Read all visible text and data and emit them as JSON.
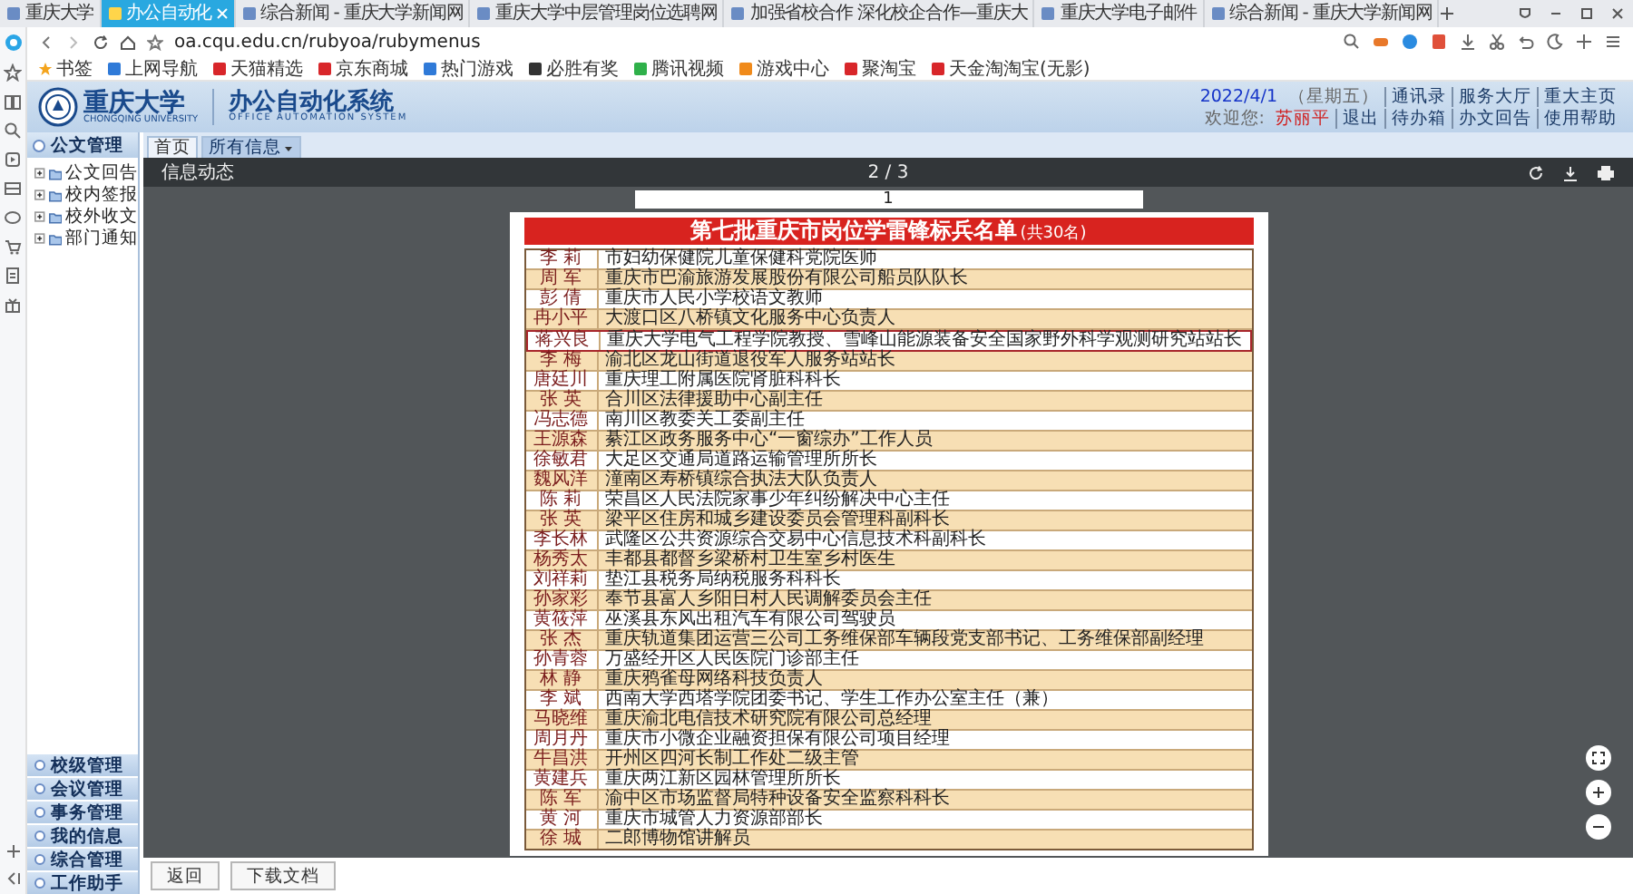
{
  "browser": {
    "tabs": [
      {
        "title": "重庆大学",
        "selected": false
      },
      {
        "title": "办公自动化",
        "selected": true
      },
      {
        "title": "综合新闻 - 重庆大学新闻网",
        "selected": false
      },
      {
        "title": "重庆大学中层管理岗位选聘网",
        "selected": false
      },
      {
        "title": "加强省校合作 深化校企合作—重庆大",
        "selected": false
      },
      {
        "title": "重庆大学电子邮件",
        "selected": false
      },
      {
        "title": "综合新闻 - 重庆大学新闻网",
        "selected": false
      }
    ],
    "address": "oa.cqu.edu.cn/rubyoa/rubymenus",
    "bookmarks": [
      "书签",
      "上网导航",
      "天猫精选",
      "京东商城",
      "热门游戏",
      "必胜有奖",
      "腾讯视频",
      "游戏中心",
      "聚淘宝",
      "天金淘淘宝(无影)"
    ]
  },
  "header": {
    "logo_text": "重庆大学",
    "logo_subtitle": "CHONGQING UNIVERSITY",
    "system_title": "办公自动化系统",
    "system_subtitle": "OFFICE AUTOMATION SYSTEM",
    "date": "2022/4/1",
    "weekday": "（星期五）",
    "top_links": [
      "通讯录",
      "服务大厅",
      "重大主页"
    ],
    "welcome": "欢迎您:",
    "user": "苏丽平",
    "user_links": [
      "退出",
      "待办箱",
      "办文回告",
      "使用帮助"
    ]
  },
  "sidebar": {
    "header": "公文管理",
    "tree": [
      {
        "label": "公文回告",
        "expanded": false
      },
      {
        "label": "校内签报",
        "expanded": false
      },
      {
        "label": "校外收文",
        "expanded": false
      },
      {
        "label": "部门通知",
        "expanded": false
      }
    ],
    "sections": [
      "校级管理",
      "会议管理",
      "事务管理",
      "我的信息",
      "综合管理",
      "工作助手"
    ]
  },
  "nav_tabs": [
    {
      "label": "首页",
      "selected": false,
      "dropdown": false
    },
    {
      "label": "所有信息",
      "selected": true,
      "dropdown": true
    }
  ],
  "viewer": {
    "title": "信息动态",
    "page": "2 / 3",
    "previous_page_number": "1",
    "document": {
      "title": "第七批重庆市岗位学雷锋标兵名单",
      "count": "(共30名)",
      "rows": [
        {
          "name": "李 莉",
          "duty": "市妇幼保健院儿童保健科党院医师",
          "highlighted": false
        },
        {
          "name": "周 军",
          "duty": "重庆市巴渝旅游发展股份有限公司船员队队长",
          "highlighted": false
        },
        {
          "name": "彭 倩",
          "duty": "重庆市人民小学校语文教师",
          "highlighted": false
        },
        {
          "name": "冉小平",
          "duty": "大渡口区八桥镇文化服务中心负责人",
          "highlighted": false
        },
        {
          "name": "蒋兴良",
          "duty": "重庆大学电气工程学院教授、雪峰山能源装备安全国家野外科学观测研究站站长",
          "highlighted": true
        },
        {
          "name": "李 梅",
          "duty": "渝北区龙山街道退役军人服务站站长",
          "highlighted": false
        },
        {
          "name": "唐廷川",
          "duty": "重庆理工附属医院肾脏科科长",
          "highlighted": false
        },
        {
          "name": "张 英",
          "duty": "合川区法律援助中心副主任",
          "highlighted": false
        },
        {
          "name": "冯志德",
          "duty": "南川区教委关工委副主任",
          "highlighted": false
        },
        {
          "name": "王源森",
          "duty": "綦江区政务服务中心“一窗综办”工作人员",
          "highlighted": false
        },
        {
          "name": "徐敏君",
          "duty": "大足区交通局道路运输管理所所长",
          "highlighted": false
        },
        {
          "name": "魏风洋",
          "duty": "潼南区寿桥镇综合执法大队负责人",
          "highlighted": false
        },
        {
          "name": "陈 莉",
          "duty": "荣昌区人民法院家事少年纠纷解决中心主任",
          "highlighted": false
        },
        {
          "name": "张 英",
          "duty": "梁平区住房和城乡建设委员会管理科副科长",
          "highlighted": false
        },
        {
          "name": "李长林",
          "duty": "武隆区公共资源综合交易中心信息技术科副科长",
          "highlighted": false
        },
        {
          "name": "杨秀太",
          "duty": "丰都县都督乡梁桥村卫生室乡村医生",
          "highlighted": false
        },
        {
          "name": "刘祥莉",
          "duty": "垫江县税务局纳税服务科科长",
          "highlighted": false
        },
        {
          "name": "孙家彩",
          "duty": "奉节县富人乡阳日村人民调解委员会主任",
          "highlighted": false
        },
        {
          "name": "黄筱萍",
          "duty": "巫溪县东风出租汽车有限公司驾驶员",
          "highlighted": false
        },
        {
          "name": "张 杰",
          "duty": "重庆轨道集团运营三公司工务维保部车辆段党支部书记、工务维保部副经理",
          "highlighted": false
        },
        {
          "name": "孙青蓉",
          "duty": "万盛经开区人民医院门诊部主任",
          "highlighted": false
        },
        {
          "name": "林 静",
          "duty": "重庆鸦雀母网络科技负责人",
          "highlighted": false
        },
        {
          "name": "李 斌",
          "duty": "西南大学西塔学院团委书记、学生工作办公室主任（兼）",
          "highlighted": false
        },
        {
          "name": "马晓维",
          "duty": "重庆渝北电信技术研究院有限公司总经理",
          "highlighted": false
        },
        {
          "name": "周月丹",
          "duty": "重庆市小微企业融资担保有限公司项目经理",
          "highlighted": false
        },
        {
          "name": "牛昌洪",
          "duty": "开州区四河长制工作处二级主管",
          "highlighted": false
        },
        {
          "name": "黄建兵",
          "duty": "重庆两江新区园林管理所所长",
          "highlighted": false
        },
        {
          "name": "陈 军",
          "duty": "渝中区市场监督局特种设备安全监察科科长",
          "highlighted": false
        },
        {
          "name": "黄 河",
          "duty": "重庆市城管人力资源部部长",
          "highlighted": false
        },
        {
          "name": "徐 城",
          "duty": "二郎博物馆讲解员",
          "highlighted": false
        }
      ]
    }
  },
  "buttons": [
    "返回",
    "下载文档"
  ]
}
